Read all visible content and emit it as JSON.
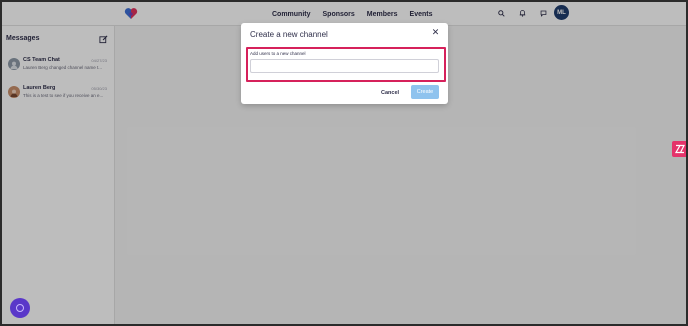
{
  "nav": {
    "links": [
      "Community",
      "Sponsors",
      "Members",
      "Events"
    ],
    "icons": [
      "search-icon",
      "bell-icon",
      "chat-icon"
    ],
    "avatar_initials": "ML"
  },
  "sidebar": {
    "title": "Messages",
    "conversations": [
      {
        "name": "CS Team Chat",
        "date": "04/27/23",
        "preview": "Lauren Berg changed channel name t..."
      },
      {
        "name": "Lauren Berg",
        "date": "05/30/23",
        "preview": "This is a test to see if you receive an e..."
      }
    ]
  },
  "modal": {
    "title": "Create a new channel",
    "field_label": "Add users to a new channel",
    "field_value": "",
    "cancel_label": "Cancel",
    "create_label": "Create"
  },
  "colors": {
    "highlight": "#d6215b",
    "create_button": "#8fc3ee",
    "avatar": "#1f3d6e",
    "help_widget": "#5a37c9",
    "zendesk_widget": "#e4336a"
  }
}
